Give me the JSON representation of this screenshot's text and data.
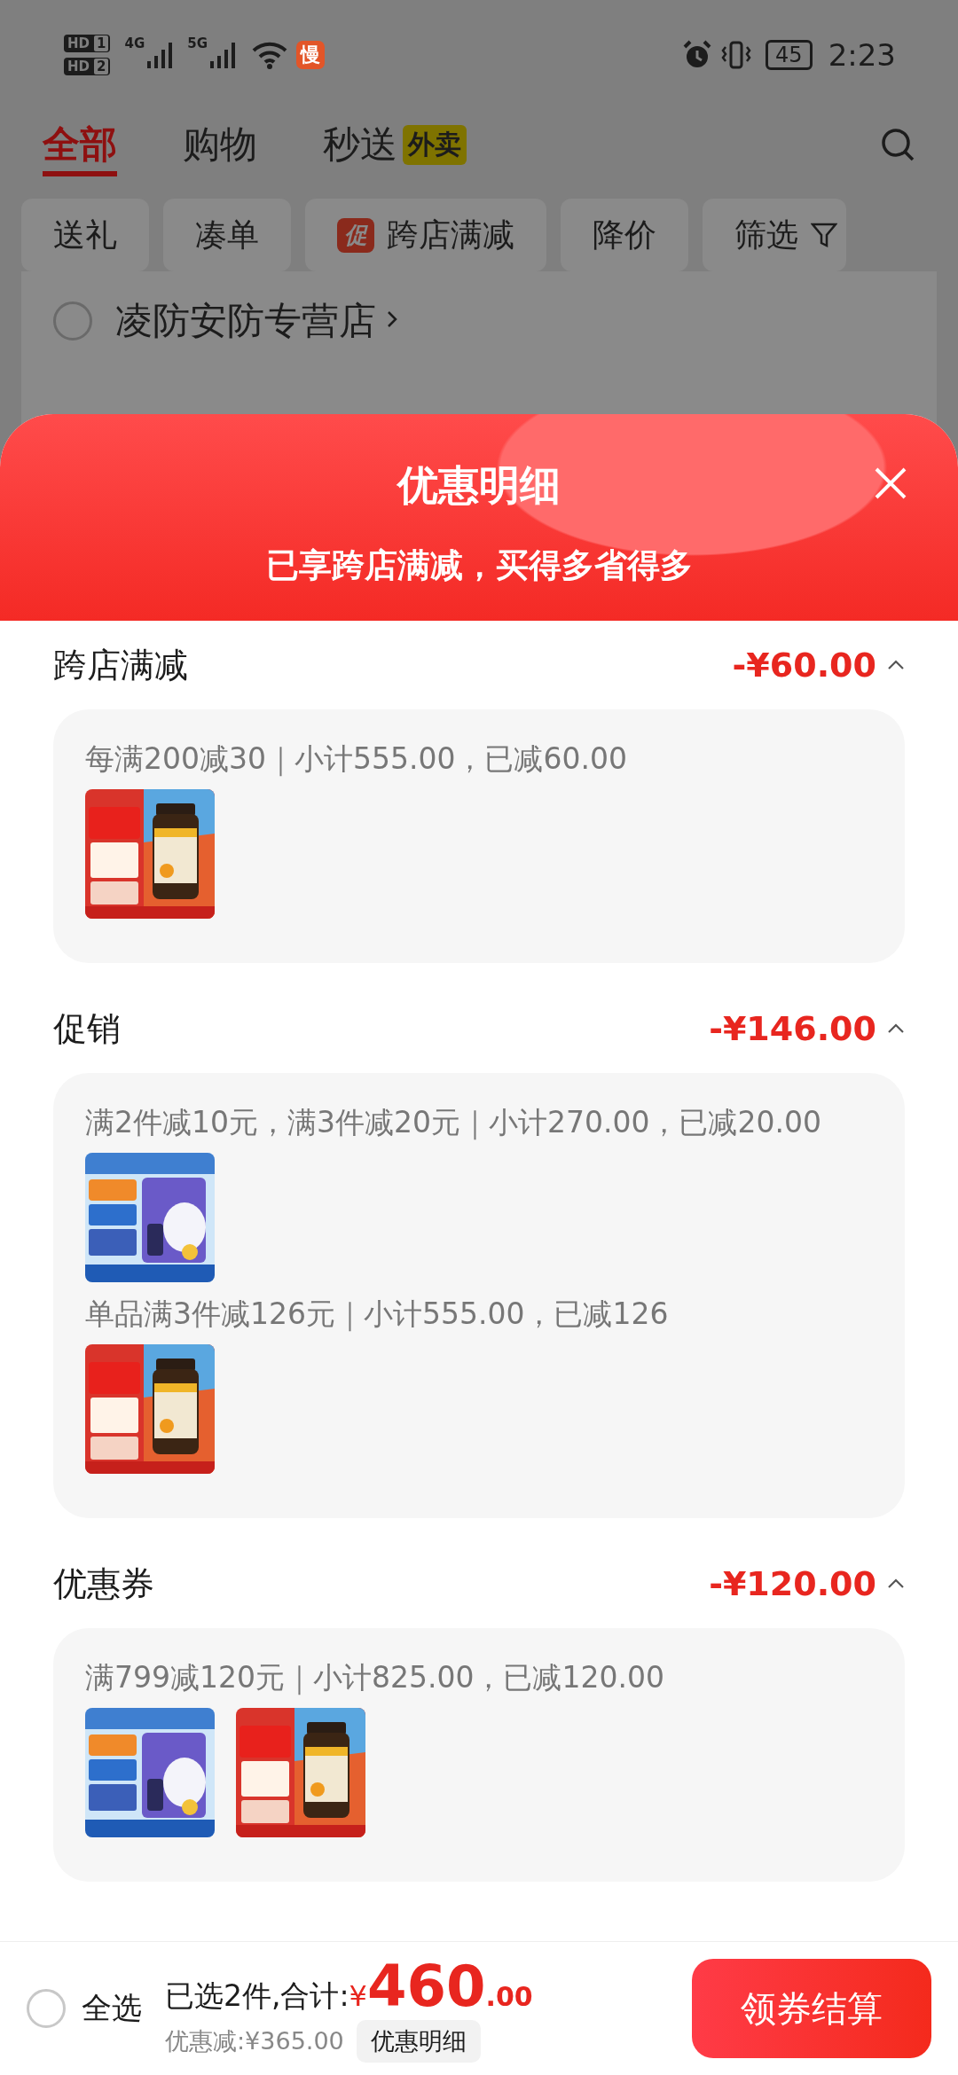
{
  "status_bar": {
    "sims": [
      {
        "label": "HD",
        "slot": "1"
      },
      {
        "label": "HD",
        "slot": "2"
      }
    ],
    "networks": [
      "4G",
      "5G"
    ],
    "app_badge": "慢",
    "battery": "45",
    "time": "2:23"
  },
  "tabs": [
    {
      "label": "全部",
      "selected": true
    },
    {
      "label": "购物",
      "selected": false
    },
    {
      "label": "秒送",
      "badge": "外卖",
      "selected": false
    }
  ],
  "filters": [
    {
      "kind": "plain",
      "label": "送礼"
    },
    {
      "kind": "plain",
      "label": "凑单"
    },
    {
      "kind": "promo",
      "badge": "促",
      "label": "跨店满减"
    },
    {
      "kind": "plain",
      "label": "降价"
    },
    {
      "kind": "filter",
      "label": "筛选"
    }
  ],
  "store": {
    "name": "凌防安防专营店",
    "checked": false
  },
  "sheet": {
    "title": "优惠明细",
    "subtitle": "已享跨店满减，买得多省得多",
    "sections": [
      {
        "title": "跨店满减",
        "amount": "-¥60.00",
        "expanded": true,
        "groups": [
          {
            "rule": "每满200减30｜小计555.00，已减60.00"
          }
        ]
      },
      {
        "title": "促销",
        "amount": "-¥146.00",
        "expanded": true,
        "groups": [
          {
            "rule": "满2件减10元，满3件减20元｜小计270.00，已减20.00"
          },
          {
            "rule": "单品满3件减126元｜小计555.00，已减126"
          }
        ]
      },
      {
        "title": "优惠券",
        "amount": "-¥120.00",
        "expanded": true,
        "groups": [
          {
            "rule": "满799减120元｜小计825.00，已减120.00"
          }
        ]
      }
    ]
  },
  "footer": {
    "select_all": {
      "label": "全选",
      "checked": false
    },
    "summary": "已选2件,合计:",
    "currency": "¥",
    "total": "460",
    "decimals": ".00",
    "discount": "优惠减:¥365.00",
    "detail_button": "优惠明细",
    "checkout": "领券结算"
  }
}
